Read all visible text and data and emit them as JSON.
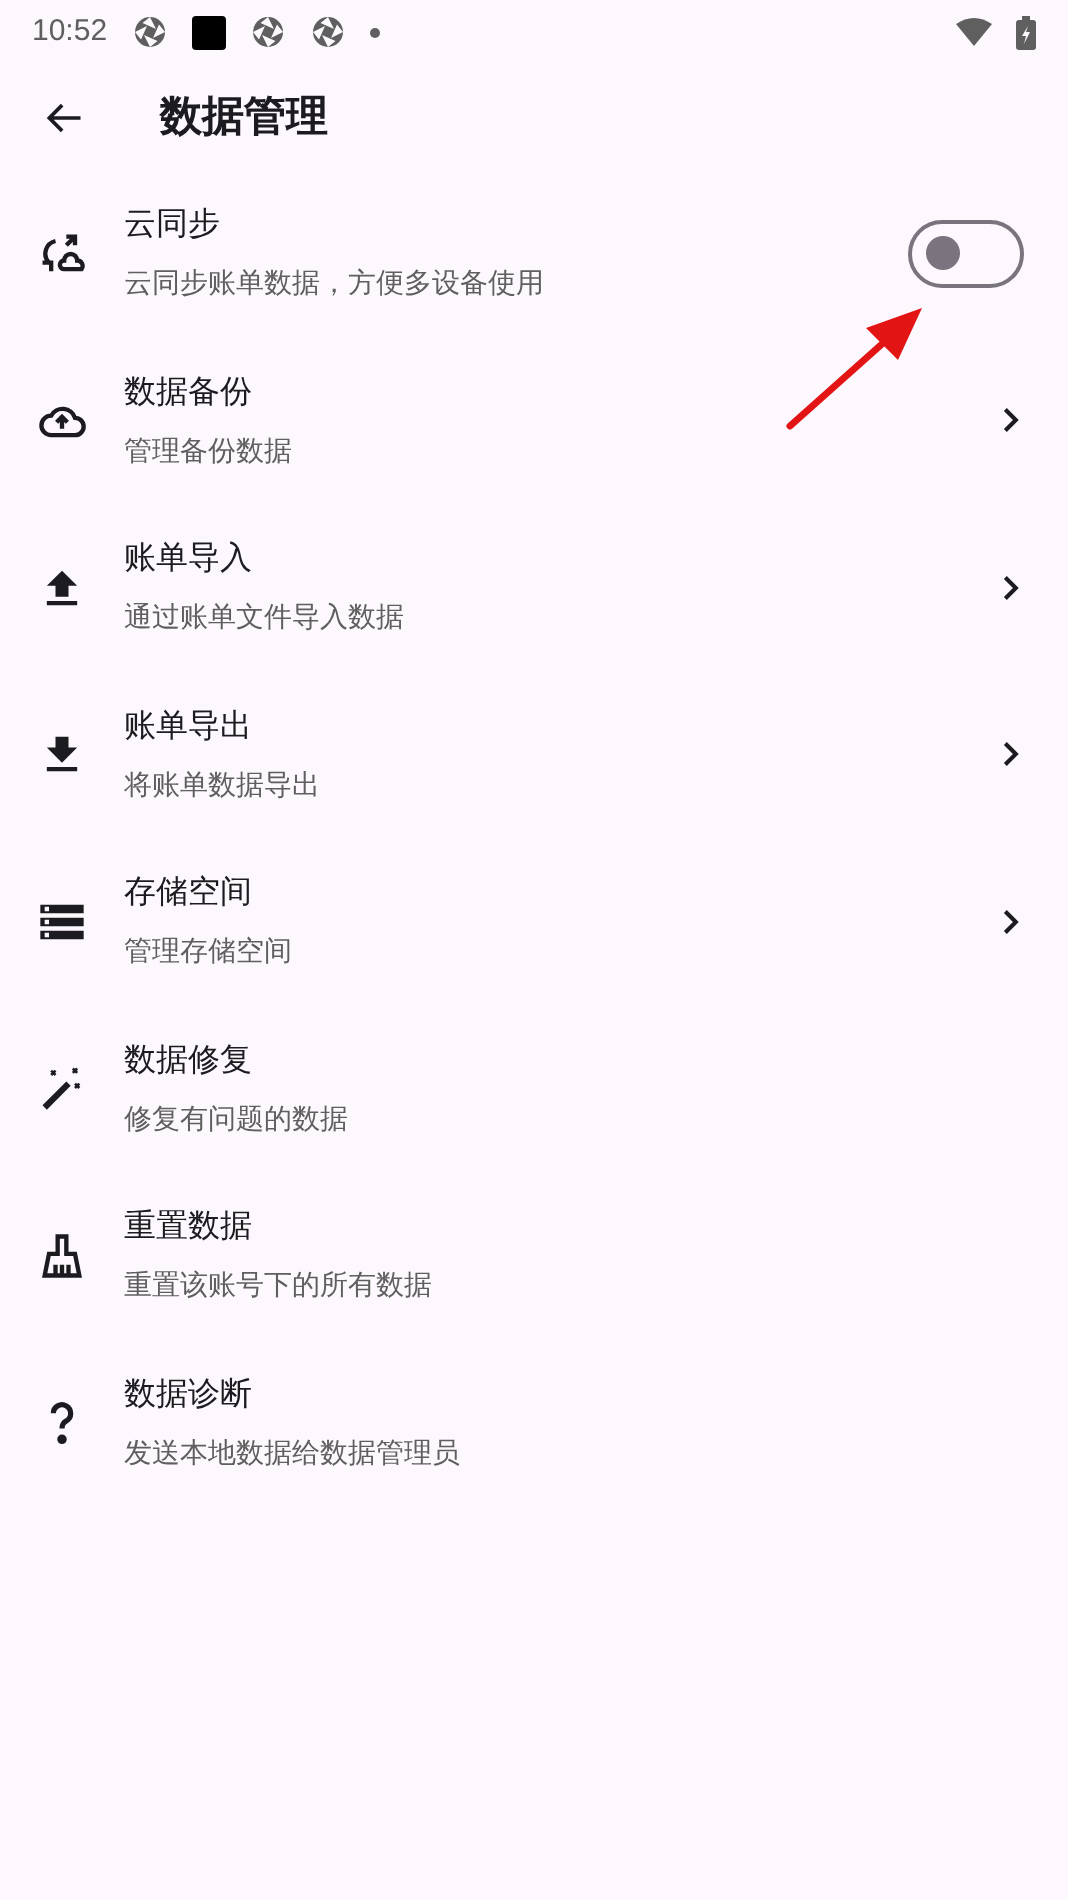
{
  "status_bar": {
    "time": "10:52"
  },
  "app_bar": {
    "title": "数据管理"
  },
  "items": [
    {
      "kind": "switch",
      "title": "云同步",
      "subtitle": "云同步账单数据，方便多设备使用",
      "on": false
    },
    {
      "kind": "link",
      "title": "数据备份",
      "subtitle": "管理备份数据"
    },
    {
      "kind": "link",
      "title": "账单导入",
      "subtitle": "通过账单文件导入数据"
    },
    {
      "kind": "link",
      "title": "账单导出",
      "subtitle": "将账单数据导出"
    },
    {
      "kind": "link",
      "title": "存储空间",
      "subtitle": "管理存储空间"
    },
    {
      "kind": "plain",
      "title": "数据修复",
      "subtitle": "修复有问题的数据"
    },
    {
      "kind": "plain",
      "title": "重置数据",
      "subtitle": "重置该账号下的所有数据"
    },
    {
      "kind": "plain",
      "title": "数据诊断",
      "subtitle": "发送本地数据给数据管理员"
    }
  ]
}
